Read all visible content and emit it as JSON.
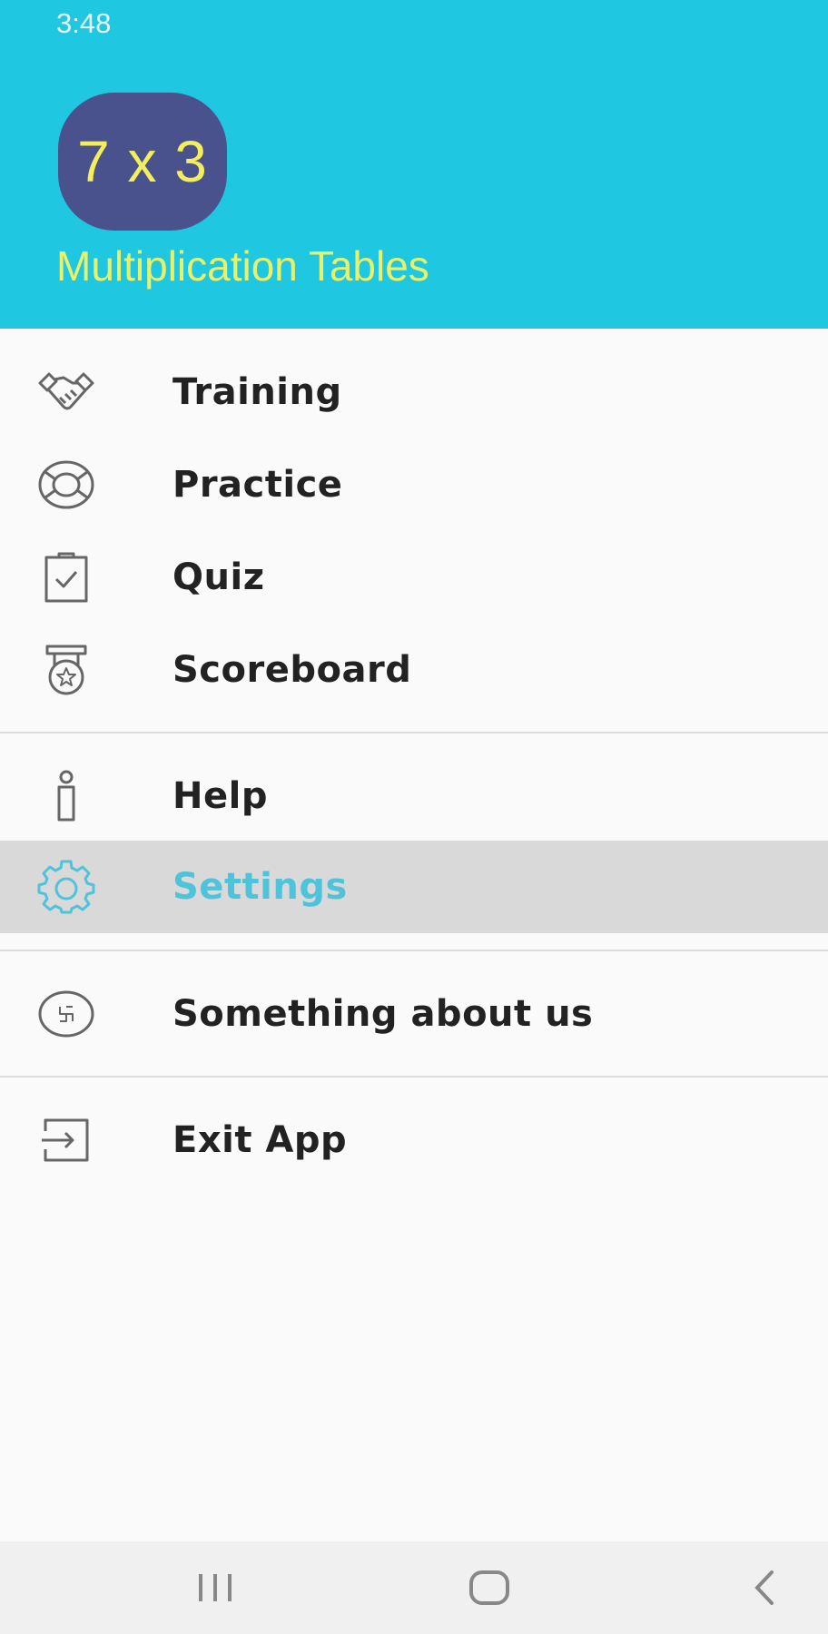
{
  "status_bar": {
    "time": "3:48"
  },
  "header": {
    "logo_text": "7 x 3",
    "app_name": "Multiplication Tables",
    "colors": {
      "background": "#1fc7e0",
      "logo_bg": "#4a528e",
      "logo_text": "#f3ee5c",
      "title": "#e9f16a"
    }
  },
  "menu": {
    "items": [
      {
        "label": "Training",
        "icon": "handshake-icon"
      },
      {
        "label": "Practice",
        "icon": "lifebuoy-icon"
      },
      {
        "label": "Quiz",
        "icon": "clipboard-check-icon"
      },
      {
        "label": "Scoreboard",
        "icon": "medal-icon"
      },
      {
        "label": "Help",
        "icon": "info-icon"
      },
      {
        "label": "Settings",
        "icon": "gear-icon",
        "selected": true
      },
      {
        "label": "Something about us",
        "icon": "about-us-icon"
      },
      {
        "label": "Exit App",
        "icon": "exit-icon"
      }
    ],
    "active_color": "#4fc3d9"
  },
  "nav_bar": {
    "buttons": [
      {
        "icon": "recent-apps-icon"
      },
      {
        "icon": "home-icon"
      },
      {
        "icon": "back-icon"
      }
    ]
  }
}
